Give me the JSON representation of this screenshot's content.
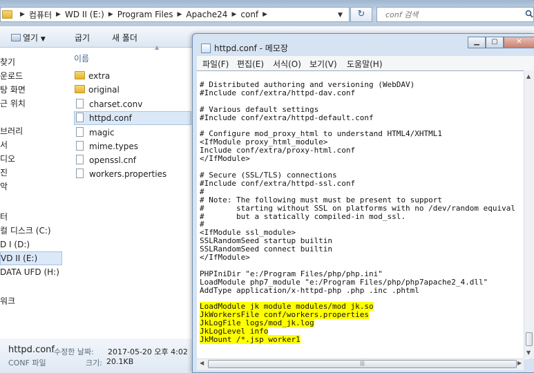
{
  "explorer": {
    "breadcrumb": [
      "컴퓨터",
      "WD II (E:)",
      "Program Files",
      "Apache24",
      "conf"
    ],
    "search_placeholder": "conf 검색",
    "toolbar": {
      "open": "열기",
      "open_arrow": "▼",
      "share": "굽기",
      "new_folder": "새 폴더"
    },
    "column_header": "이름",
    "nav": [
      "찾기",
      "운로드",
      "탕 화면",
      "근 위치",
      "브러리",
      "서",
      "디오",
      "진",
      "악",
      "터",
      "컬 디스크 (C:)",
      "D I (D:)",
      "VD II (E:)",
      "DATA UFD (H:)",
      "워크"
    ],
    "files": [
      {
        "name": "extra",
        "kind": "folder"
      },
      {
        "name": "original",
        "kind": "folder"
      },
      {
        "name": "charset.conv",
        "kind": "file"
      },
      {
        "name": "httpd.conf",
        "kind": "file",
        "selected": true
      },
      {
        "name": "magic",
        "kind": "file"
      },
      {
        "name": "mime.types",
        "kind": "file"
      },
      {
        "name": "openssl.cnf",
        "kind": "file"
      },
      {
        "name": "workers.properties",
        "kind": "file"
      }
    ],
    "status": {
      "name": "httpd.conf",
      "modified_label": "수정한 날짜:",
      "modified_value": "2017-05-20 오후 4:02",
      "type": "CONF 파일",
      "size_label": "크기:",
      "size_value": "20.1KB"
    }
  },
  "notepad": {
    "title": "httpd.conf - 메모장",
    "menu": [
      "파일(F)",
      "편집(E)",
      "서식(O)",
      "보기(V)",
      "도움말(H)"
    ],
    "lines": [
      "# Distributed authoring and versioning (WebDAV)",
      "#Include conf/extra/httpd-dav.conf",
      "",
      "# Various default settings",
      "#Include conf/extra/httpd-default.conf",
      "",
      "# Configure mod_proxy_html to understand HTML4/XHTML1",
      "<IfModule proxy_html_module>",
      "Include conf/extra/proxy-html.conf",
      "</IfModule>",
      "",
      "# Secure (SSL/TLS) connections",
      "#Include conf/extra/httpd-ssl.conf",
      "#",
      "# Note: The following must must be present to support",
      "#       starting without SSL on platforms with no /dev/random equival",
      "#       but a statically compiled-in mod_ssl.",
      "#",
      "<IfModule ssl_module>",
      "SSLRandomSeed startup builtin",
      "SSLRandomSeed connect builtin",
      "</IfModule>",
      "",
      "PHPIniDir \"e:/Program Files/php/php.ini\"",
      "LoadModule php7_module \"e:/Program Files/php/php7apache2_4.dll\"",
      "AddType application/x-httpd-php .php .inc .phtml",
      ""
    ],
    "highlighted_lines": [
      "LoadModule jk_module modules/mod_jk.so",
      "JkWorkersFile conf/workers.properties",
      "JkLogFile logs/mod_jk.log",
      "JkLogLevel info",
      "JkMount /*.jsp worker1"
    ],
    "highlight_color": "#ffff00"
  }
}
